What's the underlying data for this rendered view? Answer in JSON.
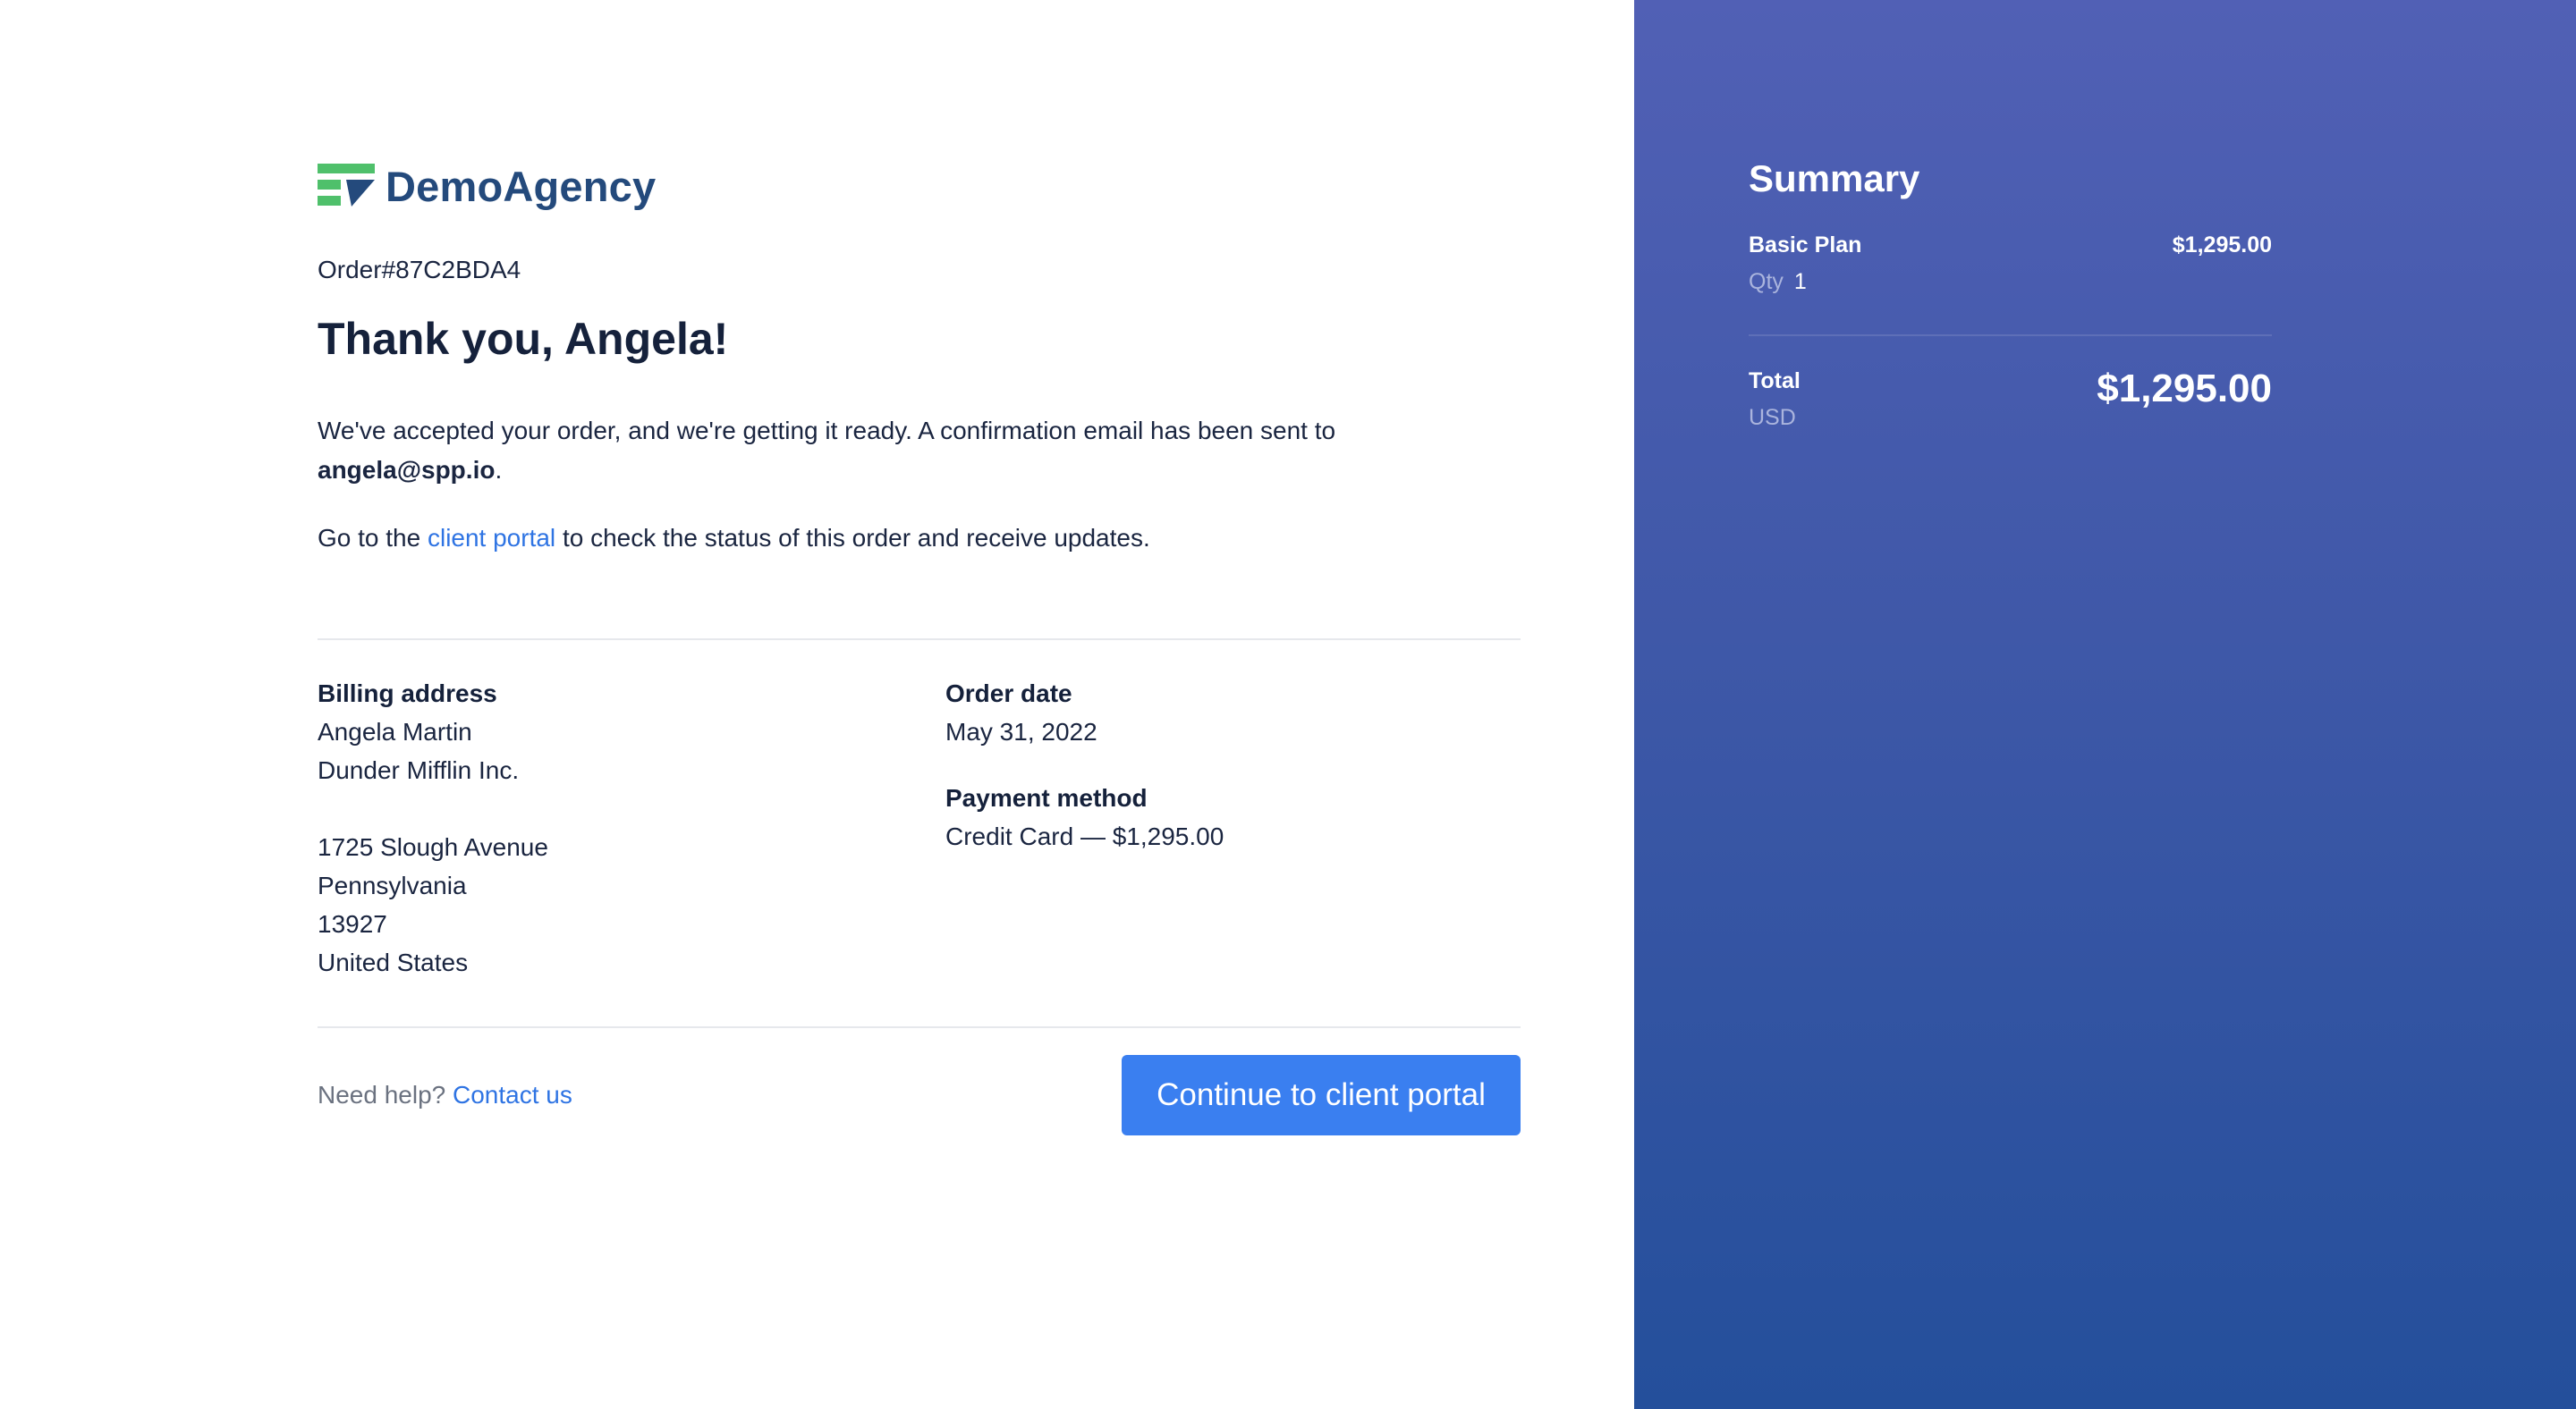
{
  "brand": {
    "name": "DemoAgency",
    "colors": {
      "text": "#244a7c",
      "accent": "#4fc06b"
    }
  },
  "order": {
    "number": "Order#87C2BDA4",
    "greeting": "Thank you, Angela!",
    "message_before_email": "We've accepted your order, and we're getting it ready. A confirmation email has been sent to",
    "email": "angela@spp.io",
    "message_after_email": ".",
    "portal_prefix": "Go to the",
    "portal_link": "client portal",
    "portal_suffix": "to check the status of this order and receive updates."
  },
  "billing": {
    "label": "Billing address",
    "name": "Angela Martin",
    "company": "Dunder Mifflin Inc.",
    "street": "1725 Slough Avenue",
    "state": "Pennsylvania",
    "zip": "13927",
    "country": "United States"
  },
  "order_date": {
    "label": "Order date",
    "value": "May 31, 2022"
  },
  "payment": {
    "label": "Payment method",
    "value": "Credit Card — $1,295.00"
  },
  "footer": {
    "help_text": "Need help?",
    "contact_link": "Contact us",
    "cta_label": "Continue to client portal",
    "cta_color": "#3a7ff0"
  },
  "summary": {
    "title": "Summary",
    "item_name": "Basic Plan",
    "item_price": "$1,295.00",
    "qty_label": "Qty",
    "qty_value": "1",
    "total_label": "Total",
    "currency": "USD",
    "total_amount": "$1,295.00",
    "panel_colors": {
      "top": "#5160b5",
      "bottom": "#244f9b"
    }
  }
}
